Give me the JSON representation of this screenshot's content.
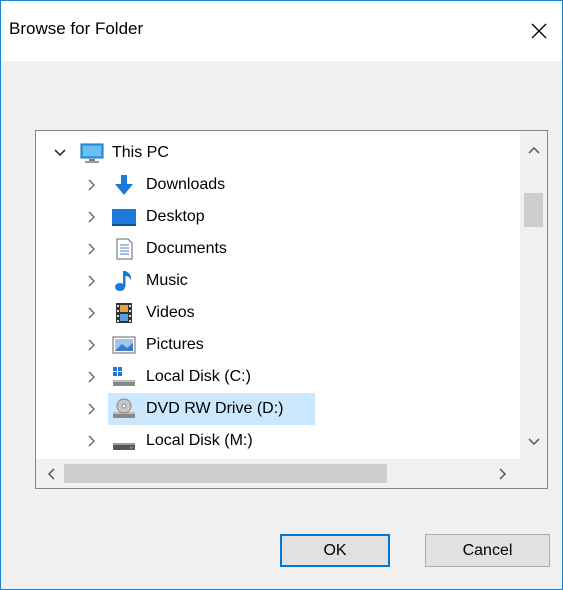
{
  "dialog": {
    "title": "Browse for Folder"
  },
  "tree": {
    "items": [
      {
        "label": "This PC",
        "icon": "monitor-icon",
        "expanded": true,
        "level": 0
      },
      {
        "label": "Downloads",
        "icon": "download-arrow-icon",
        "level": 1
      },
      {
        "label": "Desktop",
        "icon": "desktop-icon",
        "level": 1
      },
      {
        "label": "Documents",
        "icon": "document-icon",
        "level": 1
      },
      {
        "label": "Music",
        "icon": "music-note-icon",
        "level": 1
      },
      {
        "label": "Videos",
        "icon": "film-strip-icon",
        "level": 1
      },
      {
        "label": "Pictures",
        "icon": "picture-icon",
        "level": 1
      },
      {
        "label": "Local Disk (C:)",
        "icon": "windows-drive-icon",
        "level": 1
      },
      {
        "label": "DVD RW Drive (D:)",
        "icon": "dvd-drive-icon",
        "level": 1,
        "selected": true
      },
      {
        "label": "Local Disk (M:)",
        "icon": "hard-drive-icon",
        "level": 1
      }
    ]
  },
  "buttons": {
    "ok": "OK",
    "cancel": "Cancel"
  },
  "colors": {
    "accent": "#0078d7",
    "selection": "#cce8ff",
    "window_border": "#1883d7"
  }
}
